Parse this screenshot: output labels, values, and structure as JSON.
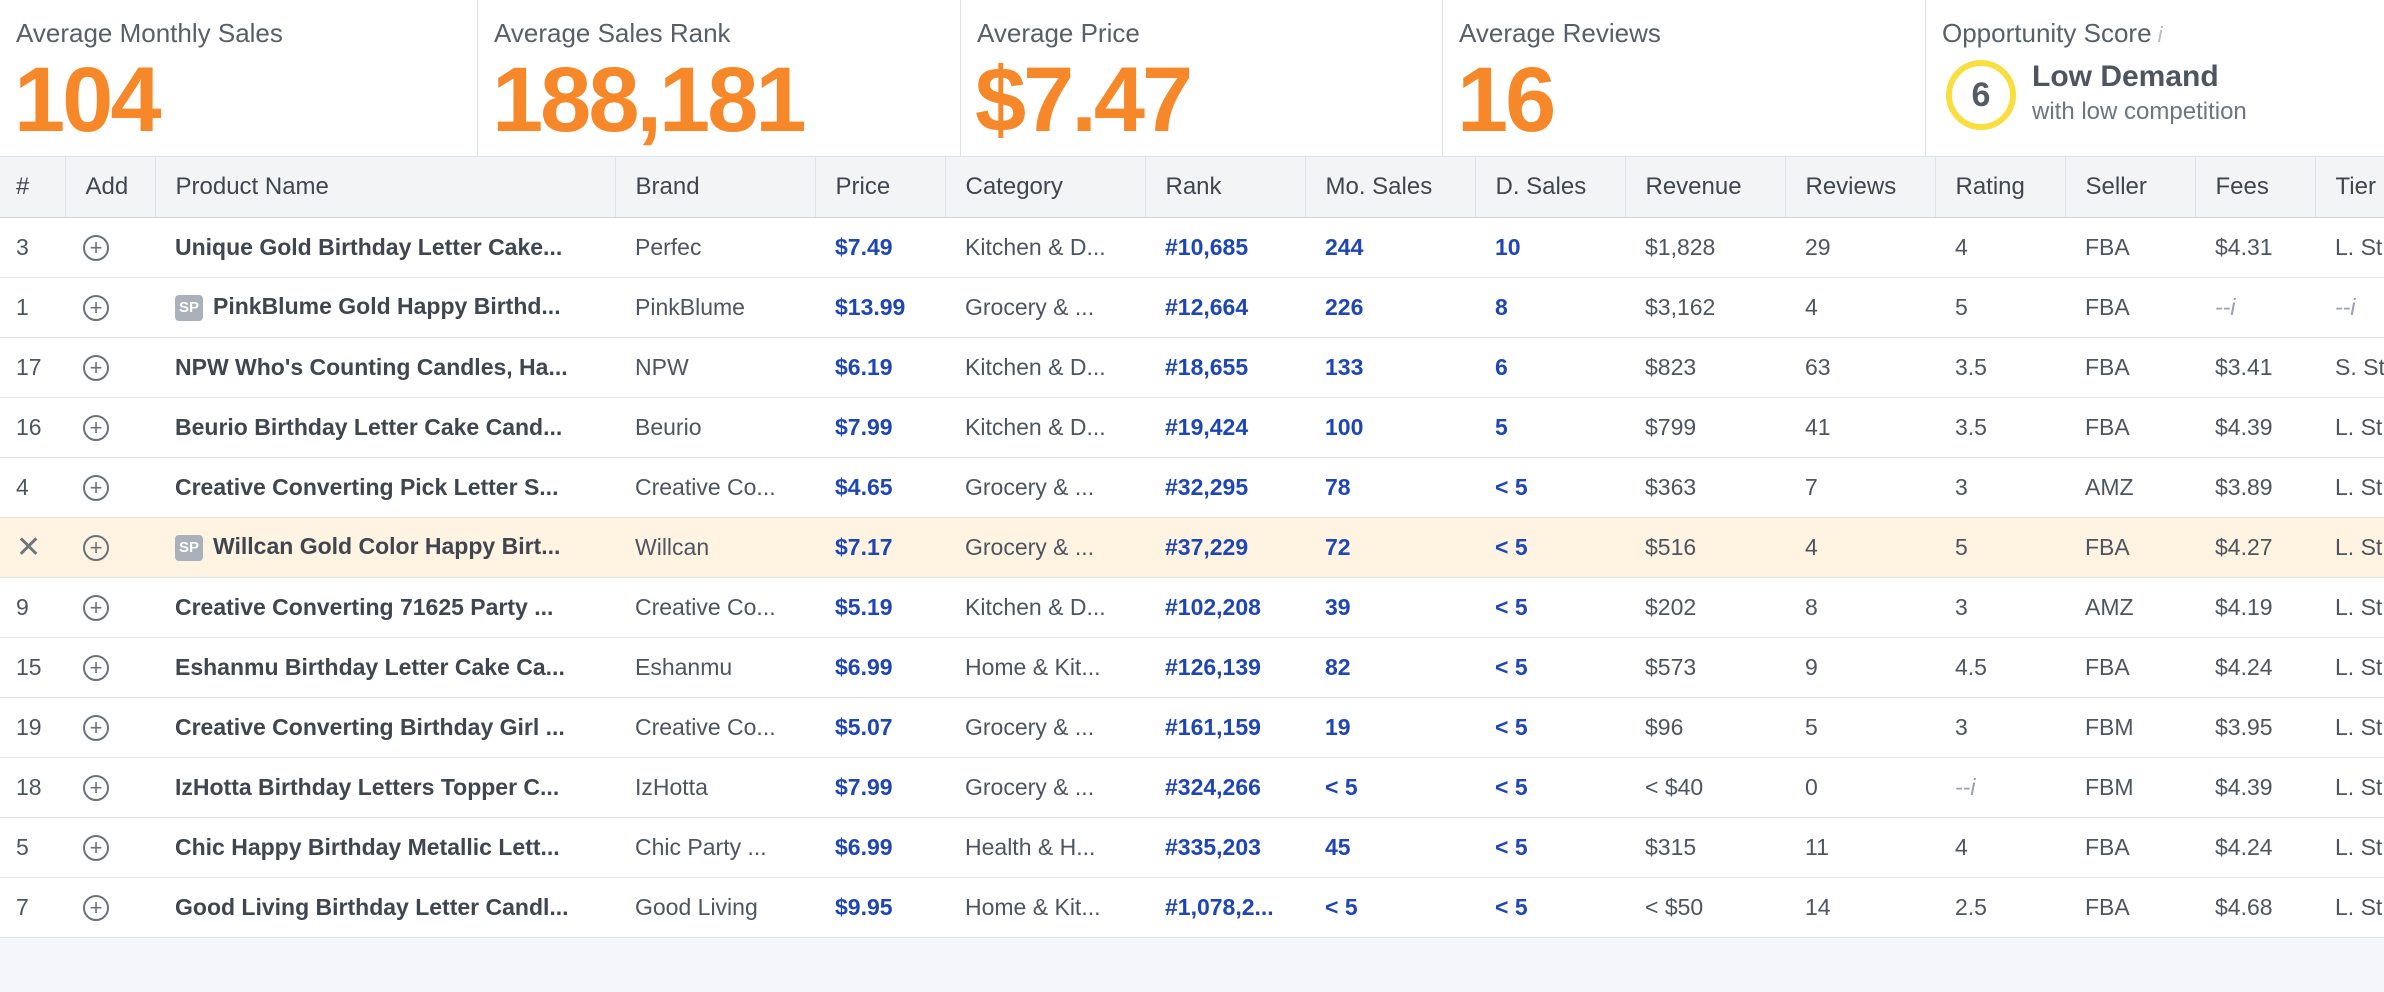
{
  "stats": {
    "avg_monthly_sales": {
      "label": "Average Monthly Sales",
      "value": "104"
    },
    "avg_sales_rank": {
      "label": "Average Sales Rank",
      "value": "188,181"
    },
    "avg_price": {
      "label": "Average Price",
      "value": "$7.47"
    },
    "avg_reviews": {
      "label": "Average Reviews",
      "value": "16"
    },
    "opportunity": {
      "label": "Opportunity Score",
      "info": "i",
      "score": "6",
      "title": "Low Demand",
      "subtitle": "with low competition"
    }
  },
  "colors": {
    "accent": "#f6882a",
    "link_blue": "#1e46b4",
    "highlight_row": "#fff3e2",
    "score_ring": "#f8df3f"
  },
  "table": {
    "headers": [
      "#",
      "Add",
      "Product Name",
      "Brand",
      "Price",
      "Category",
      "Rank",
      "Mo. Sales",
      "D. Sales",
      "Revenue",
      "Reviews",
      "Rating",
      "Seller",
      "Fees",
      "Tier"
    ],
    "rows": [
      {
        "num": "3",
        "sp": "",
        "name": "Unique Gold Birthday Letter Cake...",
        "brand": "Perfec",
        "price": "$7.49",
        "category": "Kitchen & D...",
        "rank": "#10,685",
        "mo_sales": "244",
        "d_sales": "10",
        "revenue": "$1,828",
        "reviews": "29",
        "rating": "4",
        "seller": "FBA",
        "fees": "$4.31",
        "tier": "L. St"
      },
      {
        "num": "1",
        "sp": "SP",
        "name": "PinkBlume Gold Happy Birthd...",
        "brand": "PinkBlume",
        "price": "$13.99",
        "category": "Grocery & ...",
        "rank": "#12,664",
        "mo_sales": "226",
        "d_sales": "8",
        "revenue": "$3,162",
        "reviews": "4",
        "rating": "5",
        "seller": "FBA",
        "fees": "--i",
        "tier": "--i"
      },
      {
        "num": "17",
        "sp": "",
        "name": "NPW Who's Counting Candles, Ha...",
        "brand": "NPW",
        "price": "$6.19",
        "category": "Kitchen & D...",
        "rank": "#18,655",
        "mo_sales": "133",
        "d_sales": "6",
        "revenue": "$823",
        "reviews": "63",
        "rating": "3.5",
        "seller": "FBA",
        "fees": "$3.41",
        "tier": "S. St"
      },
      {
        "num": "16",
        "sp": "",
        "name": "Beurio Birthday Letter Cake Cand...",
        "brand": "Beurio",
        "price": "$7.99",
        "category": "Kitchen & D...",
        "rank": "#19,424",
        "mo_sales": "100",
        "d_sales": "5",
        "revenue": "$799",
        "reviews": "41",
        "rating": "3.5",
        "seller": "FBA",
        "fees": "$4.39",
        "tier": "L. St"
      },
      {
        "num": "4",
        "sp": "",
        "name": "Creative Converting Pick Letter S...",
        "brand": "Creative Co...",
        "price": "$4.65",
        "category": "Grocery & ...",
        "rank": "#32,295",
        "mo_sales": "78",
        "d_sales": "< 5",
        "revenue": "$363",
        "reviews": "7",
        "rating": "3",
        "seller": "AMZ",
        "fees": "$3.89",
        "tier": "L. St"
      },
      {
        "num": "✕",
        "sp": "SP",
        "name": "Willcan Gold Color Happy Birt...",
        "brand": "Willcan",
        "price": "$7.17",
        "category": "Grocery & ...",
        "rank": "#37,229",
        "mo_sales": "72",
        "d_sales": "< 5",
        "revenue": "$516",
        "reviews": "4",
        "rating": "5",
        "seller": "FBA",
        "fees": "$4.27",
        "tier": "L. St"
      },
      {
        "num": "9",
        "sp": "",
        "name": "Creative Converting 71625 Party ...",
        "brand": "Creative Co...",
        "price": "$5.19",
        "category": "Kitchen & D...",
        "rank": "#102,208",
        "mo_sales": "39",
        "d_sales": "< 5",
        "revenue": "$202",
        "reviews": "8",
        "rating": "3",
        "seller": "AMZ",
        "fees": "$4.19",
        "tier": "L. St"
      },
      {
        "num": "15",
        "sp": "",
        "name": "Eshanmu Birthday Letter Cake Ca...",
        "brand": "Eshanmu",
        "price": "$6.99",
        "category": "Home & Kit...",
        "rank": "#126,139",
        "mo_sales": "82",
        "d_sales": "< 5",
        "revenue": "$573",
        "reviews": "9",
        "rating": "4.5",
        "seller": "FBA",
        "fees": "$4.24",
        "tier": "L. St"
      },
      {
        "num": "19",
        "sp": "",
        "name": "Creative Converting Birthday Girl ...",
        "brand": "Creative Co...",
        "price": "$5.07",
        "category": "Grocery & ...",
        "rank": "#161,159",
        "mo_sales": "19",
        "d_sales": "< 5",
        "revenue": "$96",
        "reviews": "5",
        "rating": "3",
        "seller": "FBM",
        "fees": "$3.95",
        "tier": "L. St"
      },
      {
        "num": "18",
        "sp": "",
        "name": "IzHotta Birthday Letters Topper C...",
        "brand": "IzHotta",
        "price": "$7.99",
        "category": "Grocery & ...",
        "rank": "#324,266",
        "mo_sales": "< 5",
        "d_sales": "< 5",
        "revenue": "< $40",
        "reviews": "0",
        "rating": "--i",
        "seller": "FBM",
        "fees": "$4.39",
        "tier": "L. St"
      },
      {
        "num": "5",
        "sp": "",
        "name": "Chic Happy Birthday Metallic Lett...",
        "brand": "Chic Party ...",
        "price": "$6.99",
        "category": "Health & H...",
        "rank": "#335,203",
        "mo_sales": "45",
        "d_sales": "< 5",
        "revenue": "$315",
        "reviews": "11",
        "rating": "4",
        "seller": "FBA",
        "fees": "$4.24",
        "tier": "L. St"
      },
      {
        "num": "7",
        "sp": "",
        "name": "Good Living Birthday Letter Candl...",
        "brand": "Good Living",
        "price": "$9.95",
        "category": "Home & Kit...",
        "rank": "#1,078,2...",
        "mo_sales": "< 5",
        "d_sales": "< 5",
        "revenue": "< $50",
        "reviews": "14",
        "rating": "2.5",
        "seller": "FBA",
        "fees": "$4.68",
        "tier": "L. St"
      }
    ]
  }
}
